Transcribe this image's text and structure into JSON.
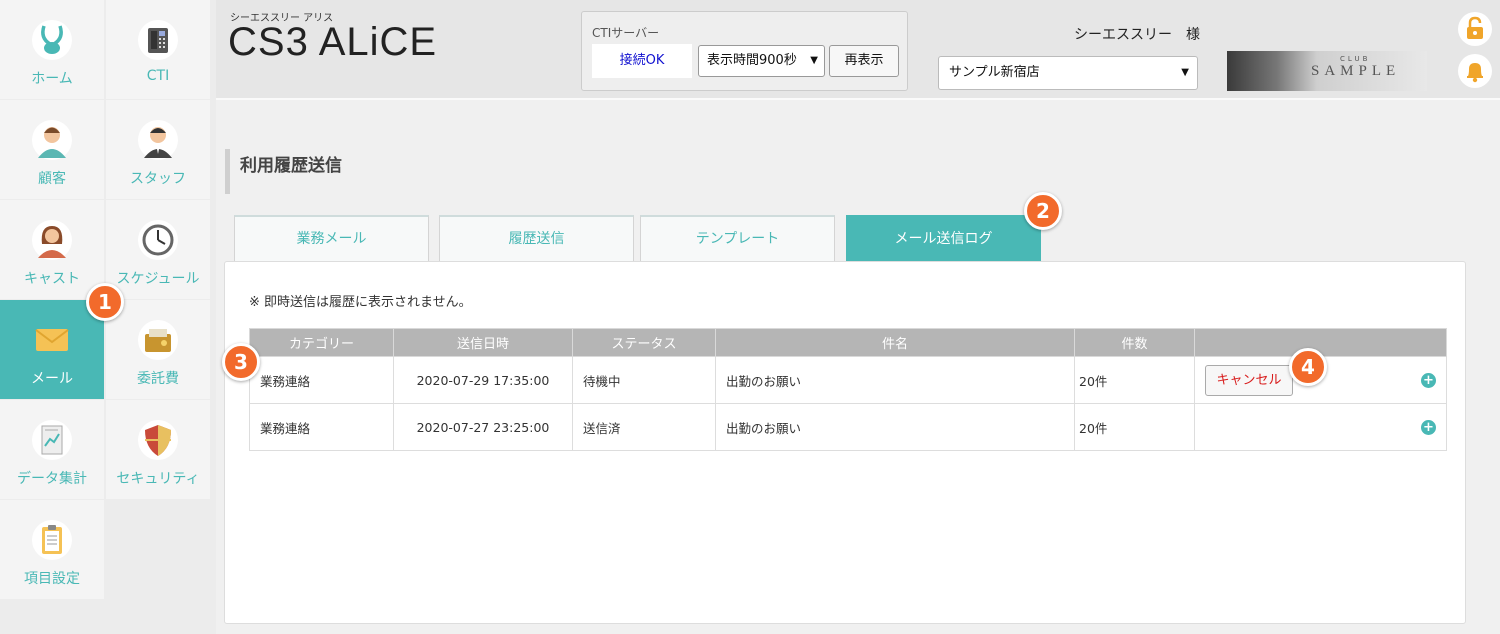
{
  "sidebar": {
    "items": [
      {
        "label": "ホーム",
        "icon": "rabbit-icon"
      },
      {
        "label": "CTI",
        "icon": "phone-icon"
      },
      {
        "label": "顧客",
        "icon": "customer-icon"
      },
      {
        "label": "スタッフ",
        "icon": "staff-icon"
      },
      {
        "label": "キャスト",
        "icon": "cast-icon"
      },
      {
        "label": "スケジュール",
        "icon": "clock-icon"
      },
      {
        "label": "メール",
        "icon": "envelope-icon",
        "active": true
      },
      {
        "label": "委託費",
        "icon": "wallet-icon"
      },
      {
        "label": "データ集計",
        "icon": "report-icon"
      },
      {
        "label": "セキュリティ",
        "icon": "shield-icon"
      },
      {
        "label": "項目設定",
        "icon": "clipboard-icon"
      }
    ]
  },
  "header": {
    "brand_sub": "シーエススリー アリス",
    "brand": "CS3 ALiCE",
    "cti": {
      "title": "CTIサーバー",
      "status": "接続OK",
      "display_time": "表示時間900秒",
      "refresh_label": "再表示"
    },
    "user_name": "シーエススリー　様",
    "shop_select": "サンプル新宿店",
    "banner": {
      "club": "CLUB",
      "name": "SAMPLE"
    }
  },
  "page": {
    "title": "利用履歴送信",
    "tabs": [
      {
        "label": "業務メール"
      },
      {
        "label": "履歴送信"
      },
      {
        "label": "テンプレート"
      },
      {
        "label": "メール送信ログ",
        "active": true
      }
    ],
    "note": "※ 即時送信は履歴に表示されません。",
    "table": {
      "headers": [
        "カテゴリー",
        "送信日時",
        "ステータス",
        "件名",
        "件数",
        ""
      ],
      "rows": [
        {
          "category": "業務連絡",
          "datetime": "2020-07-29 17:35:00",
          "status": "待機中",
          "subject": "出勤のお願い",
          "count": "20件",
          "action": "キャンセル"
        },
        {
          "category": "業務連絡",
          "datetime": "2020-07-27 23:25:00",
          "status": "送信済",
          "subject": "出勤のお願い",
          "count": "20件",
          "action": ""
        }
      ]
    }
  },
  "callouts": [
    "1",
    "2",
    "3",
    "4"
  ],
  "colors": {
    "accent": "#49b8b5",
    "callout": "#f26a2b",
    "cancel": "#d81b1b",
    "status_wait": "#1010d0"
  }
}
